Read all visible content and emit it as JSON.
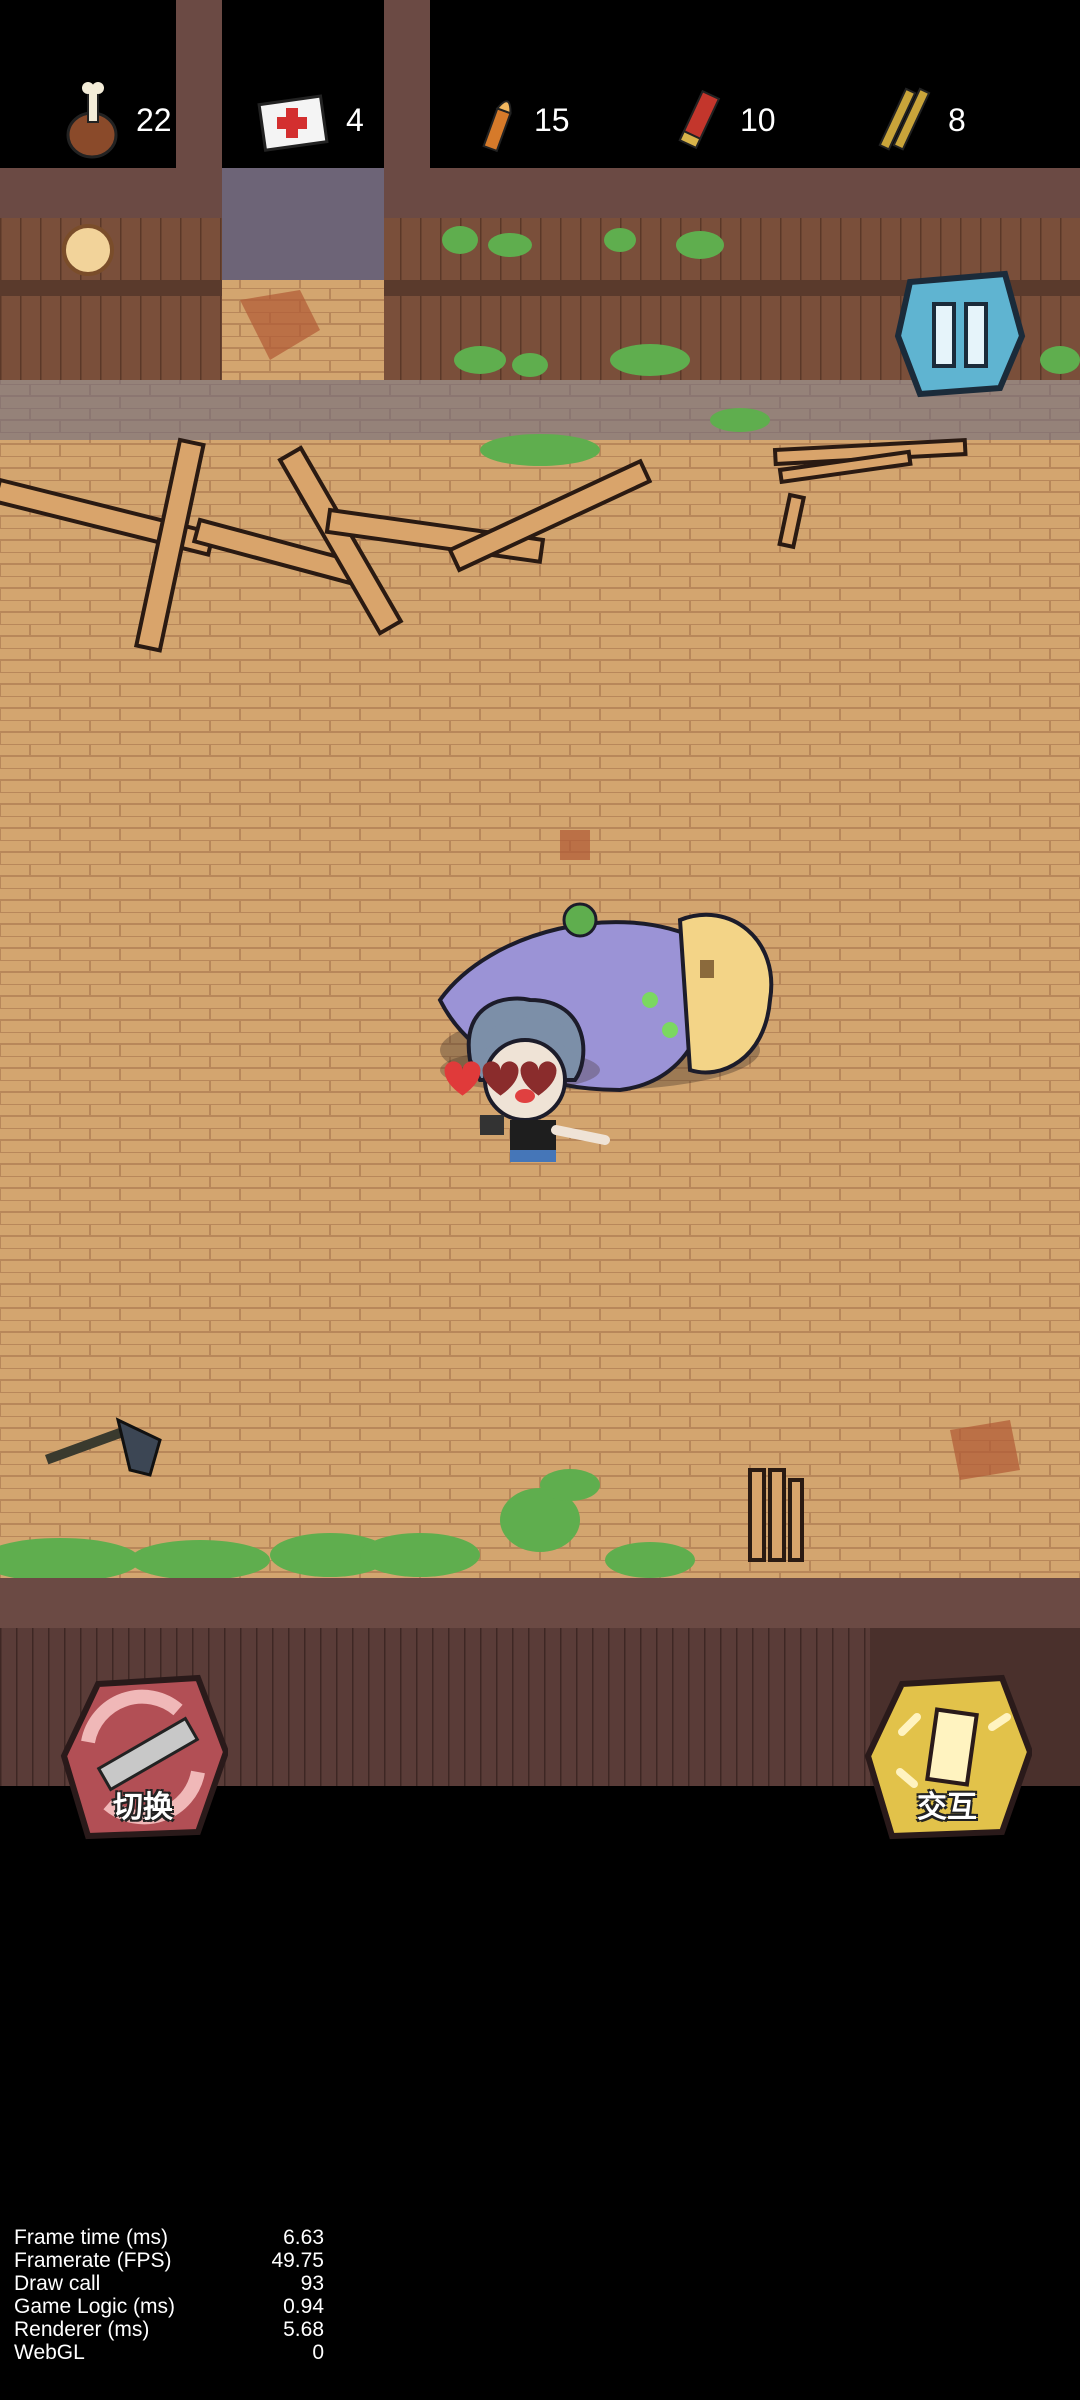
{
  "hud": {
    "resources": [
      {
        "icon": "meat-icon",
        "count": "22"
      },
      {
        "icon": "medkit-icon",
        "count": "4"
      },
      {
        "icon": "pistol-bullet-icon",
        "count": "15"
      },
      {
        "icon": "shotgun-shell-icon",
        "count": "10"
      },
      {
        "icon": "rifle-bullet-icon",
        "count": "8"
      }
    ]
  },
  "controls": {
    "switch_label": "切换",
    "interact_label": "交互"
  },
  "debug": {
    "rows": [
      {
        "label": "Frame time (ms)",
        "value": "6.63"
      },
      {
        "label": "Framerate (FPS)",
        "value": "49.75"
      },
      {
        "label": "Draw call",
        "value": "93"
      },
      {
        "label": "Game Logic (ms)",
        "value": "0.94"
      },
      {
        "label": "Renderer (ms)",
        "value": "5.68"
      },
      {
        "label": "WebGL",
        "value": "0"
      }
    ]
  },
  "colors": {
    "floor": "#d3a56f",
    "wall": "#6b4a44",
    "moss": "#5fae4e",
    "pause_button": "#5fb4d1",
    "interact_button": "#e2c24a",
    "switch_button": "#b24f55"
  }
}
